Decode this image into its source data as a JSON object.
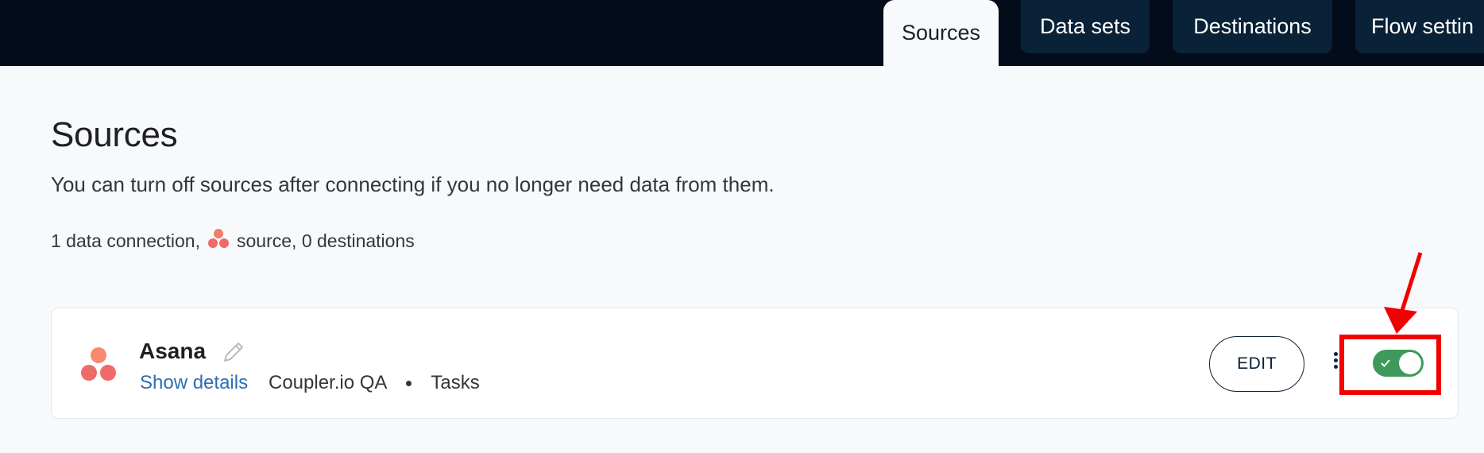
{
  "nav": {
    "tabs": [
      {
        "label": "Sources",
        "active": true
      },
      {
        "label": "Data sets",
        "active": false
      },
      {
        "label": "Destinations",
        "active": false
      },
      {
        "label": "Flow settin",
        "active": false
      }
    ]
  },
  "page": {
    "title": "Sources",
    "description": "You can turn off sources after connecting if you no longer need data from them.",
    "summary_prefix": "1 data connection,",
    "summary_middle": "source,",
    "summary_dest_count": "0",
    "summary_suffix": "destinations"
  },
  "source_card": {
    "name": "Asana",
    "show_details_label": "Show details",
    "account": "Coupler.io QA",
    "entity": "Tasks",
    "edit_label": "EDIT",
    "enabled": true,
    "logo_icon": "asana-logo",
    "edit_icon": "pencil-icon",
    "menu_icon": "kebab-menu-icon"
  },
  "colors": {
    "topbar": "#030c1b",
    "tab_bg": "#0a2238",
    "link": "#2f6db3",
    "toggle_on": "#3e9a5a",
    "annotation": "#f20000",
    "asana_pink": "#f06a6a",
    "asana_orange": "#ff8d6a"
  }
}
